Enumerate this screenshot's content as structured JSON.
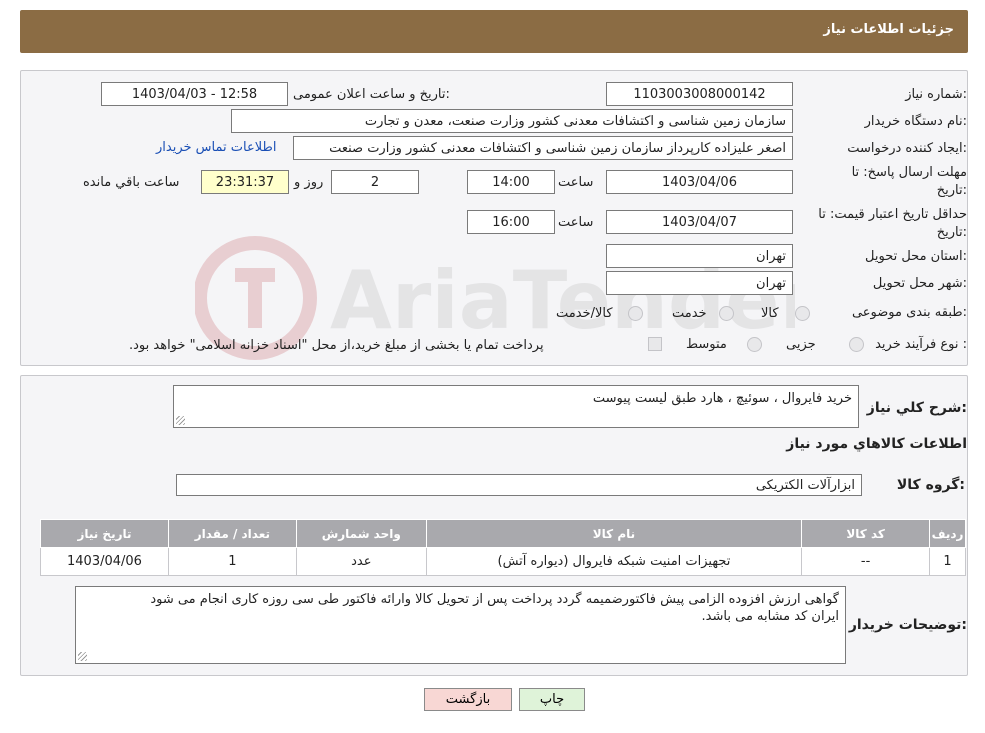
{
  "header": {
    "title": "جزئیات اطلاعات نیاز"
  },
  "form": {
    "need_number_label": "شماره نیاز:",
    "need_number": "1103003008000142",
    "announce_label": "تاریخ و ساعت اعلان عمومی:",
    "announce_value": "1403/04/03 - 12:58",
    "buyer_org_label": "نام دستگاه خریدار:",
    "buyer_org": "سازمان زمین شناسی و اکتشافات معدنی کشور وزارت صنعت، معدن و تجارت",
    "creator_label": "ایجاد کننده درخواست:",
    "creator": "اصغر علیزاده کارپرداز سازمان زمین شناسی و اکتشافات معدنی کشور وزارت صنعت",
    "contact_link": "اطلاعات تماس خریدار",
    "deadline_label_1": "مهلت ارسال پاسخ: تا",
    "deadline_label_2": "تاریخ:",
    "deadline_date": "1403/04/06",
    "time_label": "ساعت",
    "deadline_time": "14:00",
    "days_value": "2",
    "days_label": "روز و",
    "remaining_time": "23:31:37",
    "remaining_label": "ساعت باقي مانده",
    "validity_label_1": "حداقل تاریخ اعتبار قیمت: تا",
    "validity_label_2": "تاریخ:",
    "validity_date": "1403/04/07",
    "validity_time": "16:00",
    "province_label": "استان محل تحویل:",
    "province": "تهران",
    "city_label": "شهر محل تحویل:",
    "city": "تهران",
    "category_label": "طبقه بندی موضوعی:",
    "category_options": [
      "کالا",
      "خدمت",
      "کالا/خدمت"
    ],
    "process_label": "نوع فرآیند خرید :",
    "process_options": [
      "جزیی",
      "متوسط"
    ],
    "process_note": "پرداخت تمام یا بخشی از مبلغ خرید،از محل \"اسناد خزانه اسلامی\" خواهد بود."
  },
  "details": {
    "summary_label": "شرح کلي نياز:",
    "summary": "خرید فایروال ، سوئیچ ، هارد طبق لیست پیوست",
    "goods_info_title": "اطلاعات کالاهاي مورد نياز",
    "goods_group_label": "گروه کالا:",
    "goods_group": "ابزارآلات الکتریکی",
    "table": {
      "headers": [
        "رديف",
        "کد کالا",
        "نام کالا",
        "واحد شمارش",
        "تعداد / مقدار",
        "تاریخ نیاز"
      ],
      "rows": [
        [
          "1",
          "--",
          "تجهیزات امنیت شبکه فایروال (دیواره آتش)",
          "عدد",
          "1",
          "1403/04/06"
        ]
      ]
    },
    "buyer_notes_label": "توضیحات خریدار:",
    "buyer_notes_line1": "گواهی ارزش افزوده الزامی پیش فاکتورضمیمه گردد پرداخت پس از تحویل کالا وارائه فاکتور طی سی روزه کاری انجام می شود",
    "buyer_notes_line2": "ایران کد مشابه می باشد."
  },
  "buttons": {
    "print": "چاپ",
    "back": "بازگشت"
  },
  "colors": {
    "header_bg": "#8b6c44",
    "link": "#1a4fb5",
    "back_btn_bg": "#f8d7d4",
    "print_btn_bg": "#dff3d9"
  }
}
